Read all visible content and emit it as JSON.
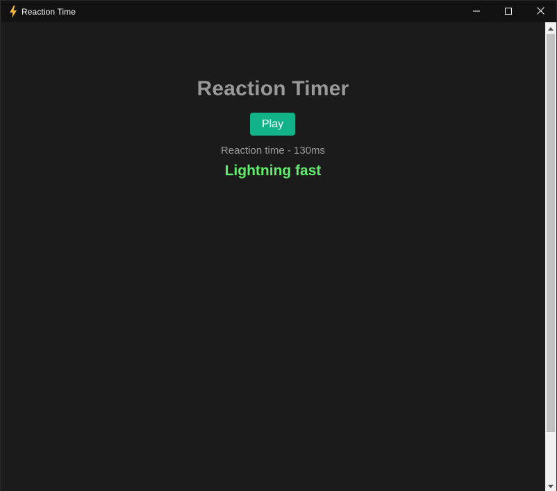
{
  "window": {
    "title": "Reaction Time",
    "app_icon": "lightning-bolt-icon",
    "controls": [
      "minimize-icon",
      "maximize-icon",
      "close-icon"
    ]
  },
  "main": {
    "heading": "Reaction Timer",
    "play_label": "Play",
    "reaction_text": "Reaction time - 130ms",
    "verdict": "Lightning fast"
  },
  "colors": {
    "accent_button": "#13b38a",
    "verdict_text": "#5ef06a",
    "heading_text": "#999999",
    "background": "#1b1b1b",
    "icon_bolt": "#f6b93b"
  },
  "scrollbar": {
    "up_icon": "scroll-up-arrow-icon",
    "down_icon": "scroll-down-arrow-icon"
  }
}
